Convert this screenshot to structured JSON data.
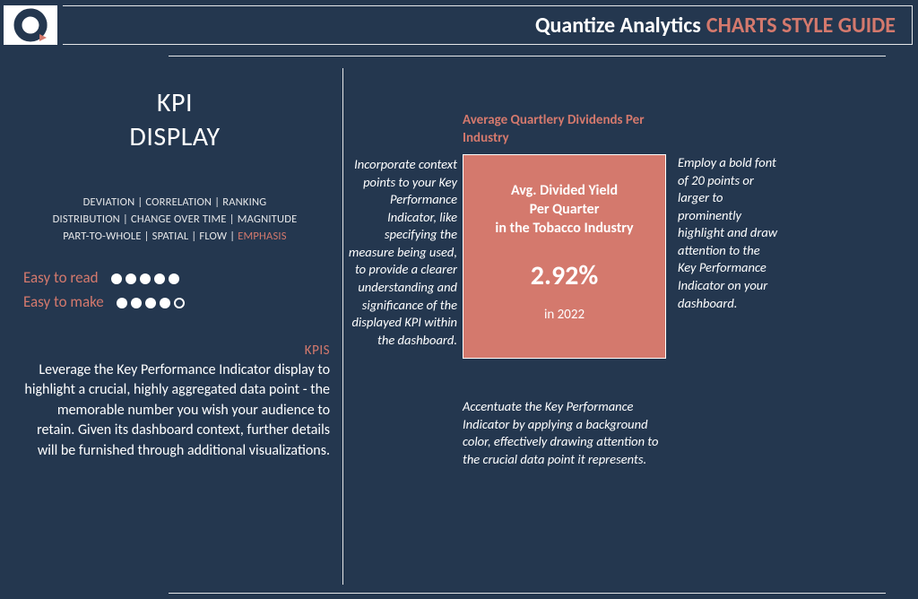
{
  "header": {
    "brand": "Quantize Analytics",
    "guide_label": "CHARTS STYLE GUIDE"
  },
  "left": {
    "title_line1": "KPI",
    "title_line2": "DISPLAY",
    "tags": [
      "DEVIATION",
      "CORRELATION",
      "RANKING",
      "DISTRIBUTION",
      "CHANGE OVER TIME",
      "MAGNITUDE",
      "PART-TO-WHOLE",
      "SPATIAL",
      "FLOW"
    ],
    "tag_emphasis": "EMPHASIS",
    "ratings": {
      "read_label": "Easy to read",
      "read_score": 5,
      "make_label": "Easy to make",
      "make_score": 4,
      "max": 5
    },
    "kpis_label": "KPIS",
    "body": "Leverage the Key Performance Indicator display to highlight a crucial, highly aggregated data point - the memorable number you wish your audience to retain. Given its dashboard context, further details will be furnished through additional visualizations."
  },
  "right": {
    "card_title": "Average Quartlery Dividends Per Industry",
    "card": {
      "line1": "Avg. Divided Yield",
      "line2": "Per Quarter",
      "line3": "in the Tobacco Industry",
      "metric": "2.92%",
      "year": "in 2022"
    },
    "annotations": {
      "left": "Incorporate context points to your Key Performance Indicator, like specifying the measure being used, to provide a clearer understanding and significance of the displayed KPI within the dashboard.",
      "right": "Employ a bold font of 20 points or larger to prominently highlight and draw attention to the Key Performance Indicator on your dashboard.",
      "bottom": "Accentuate the Key Performance Indicator by applying a background color, effectively drawing attention to the crucial data point it represents."
    }
  },
  "colors": {
    "bg": "#24374f",
    "accent": "#d4796d",
    "fg": "#ffffff"
  },
  "chart_data": {
    "type": "kpi",
    "title": "Average Quartlery Dividends Per Industry",
    "label": "Avg. Divided Yield Per Quarter in the Tobacco Industry",
    "value": 2.92,
    "unit": "%",
    "period": "2022"
  }
}
